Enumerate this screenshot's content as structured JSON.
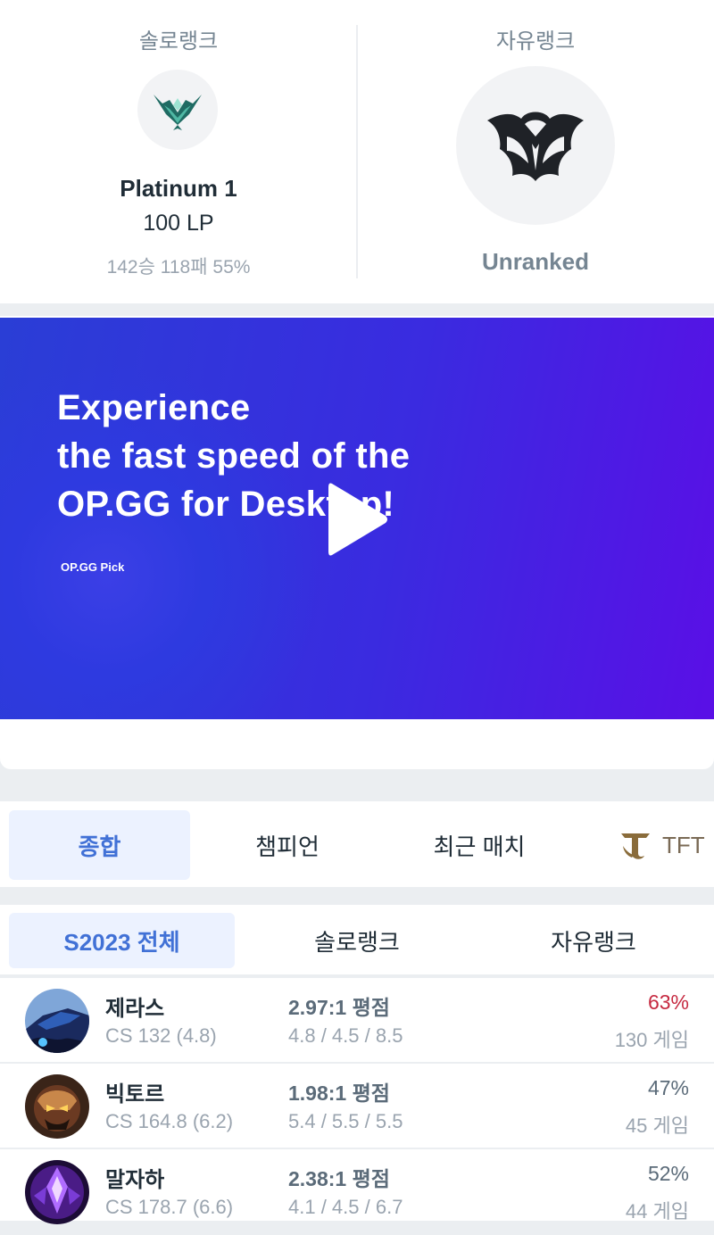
{
  "ranks": {
    "solo": {
      "label": "솔로랭크",
      "tier": "Platinum 1",
      "lp": "100 LP",
      "record": "142승 118패 55%",
      "emblem": "platinum-emblem-icon"
    },
    "flex": {
      "label": "자유랭크",
      "tier": "Unranked",
      "emblem": "unranked-emblem-icon"
    }
  },
  "ad": {
    "headline_lines": [
      "Experience",
      "the fast speed of the",
      "OP.GG for Desktop!"
    ],
    "tag": "OP.GG Pick",
    "play_icon": "play-icon"
  },
  "tabs": [
    {
      "label": "종합",
      "active": true
    },
    {
      "label": "챔피언"
    },
    {
      "label": "최근 매치"
    },
    {
      "label": "TFT",
      "icon": "tft-logo-icon"
    }
  ],
  "filters": [
    {
      "label": "S2023 전체",
      "active": true
    },
    {
      "label": "솔로랭크"
    },
    {
      "label": "자유랭크"
    }
  ],
  "champions": [
    {
      "name": "제라스",
      "cs": "CS 132 (4.8)",
      "kda": "2.97:1 평점",
      "kda_detail": "4.8 / 4.5 / 8.5",
      "winrate": "63%",
      "games": "130 게임"
    },
    {
      "name": "빅토르",
      "cs": "CS 164.8 (6.2)",
      "kda": "1.98:1 평점",
      "kda_detail": "5.4 / 5.5 / 5.5",
      "winrate": "47%",
      "games": "45 게임"
    },
    {
      "name": "말자하",
      "cs": "CS 178.7 (6.6)",
      "kda": "2.38:1 평점",
      "kda_detail": "4.1 / 4.5 / 6.7",
      "winrate": "52%",
      "games": "44 게임"
    }
  ],
  "colors": {
    "accent": "#4171d6",
    "accent_bg": "#ecf2ff",
    "high_winrate": "#c62a41",
    "banner_start": "#2a3ed6",
    "banner_end": "#5a0fe6"
  }
}
